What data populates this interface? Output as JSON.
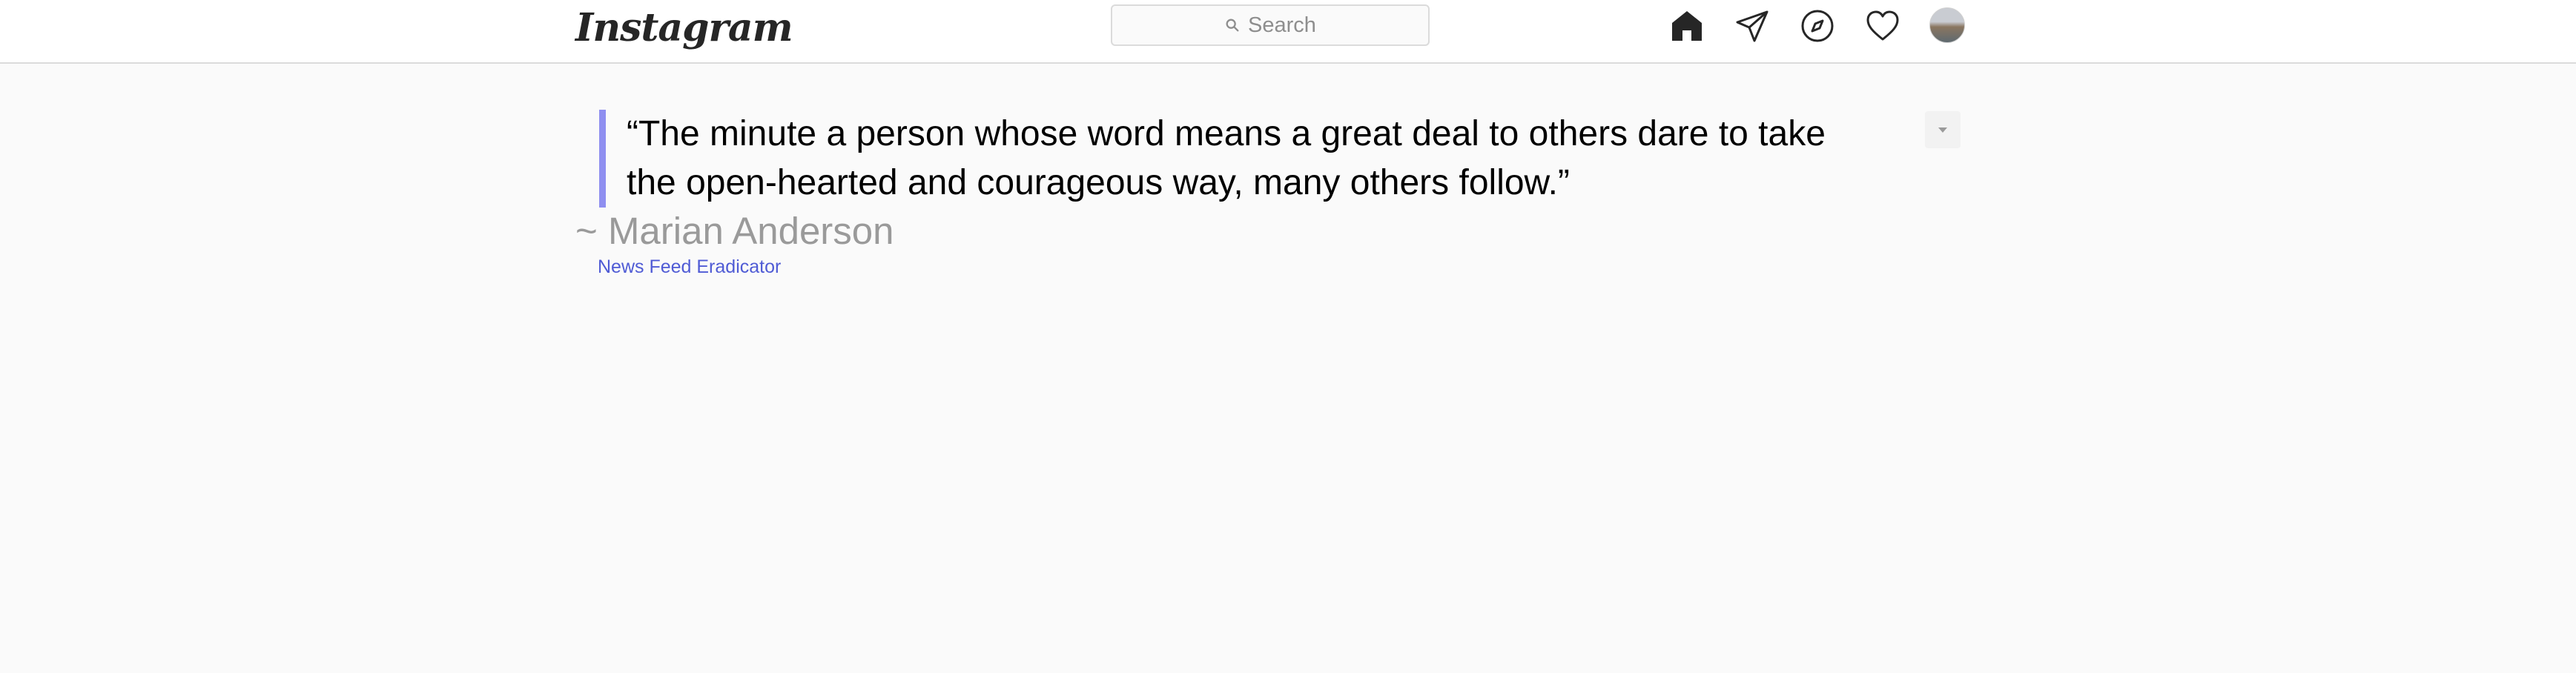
{
  "header": {
    "logo_text": "Instagram",
    "search_placeholder": "Search",
    "nav": [
      {
        "icon": "home-icon"
      },
      {
        "icon": "direct-message-icon"
      },
      {
        "icon": "explore-compass-icon"
      },
      {
        "icon": "activity-heart-icon"
      },
      {
        "icon": "profile-avatar"
      }
    ]
  },
  "quote": {
    "text_line1": "“The minute a person whose word means a great deal to others dare to take",
    "text_line2": "the open-hearted and courageous way, many others follow.”",
    "author": "~ Marian Anderson",
    "source_link": "News Feed Eradicator"
  },
  "colors": {
    "accent_bar": "#8f8ff0",
    "link": "#4f5bd5",
    "author": "#9a9a9a",
    "background": "#fafafa"
  }
}
